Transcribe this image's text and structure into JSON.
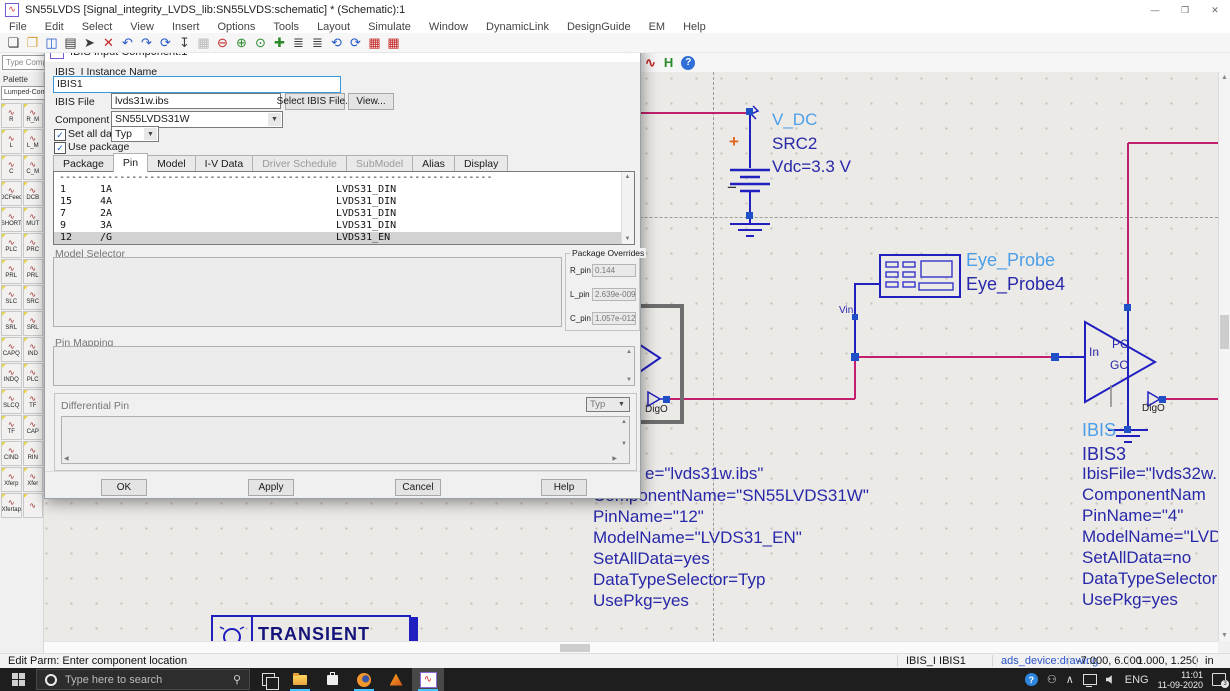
{
  "window": {
    "title": "SN55LVDS [Signal_integrity_LVDS_lib:SN55LVDS:schematic] * (Schematic):1",
    "controls": [
      {
        "g": "—",
        "n": "minimize-button"
      },
      {
        "g": "❐",
        "n": "maximize-button"
      },
      {
        "g": "✕",
        "n": "close-button"
      }
    ]
  },
  "menu": {
    "items": [
      "File",
      "Edit",
      "Select",
      "View",
      "Insert",
      "Options",
      "Tools",
      "Layout",
      "Simulate",
      "Window",
      "DynamicLink",
      "DesignGuide",
      "EM",
      "Help"
    ]
  },
  "toolbar": {
    "icons": [
      {
        "g": "❏",
        "n": "new-design-icon",
        "cls": "c-ink"
      },
      {
        "g": "❐",
        "n": "open-design-icon",
        "cls": "c-folder"
      },
      {
        "g": "◫",
        "n": "save-design-icon",
        "cls": "c-blue"
      },
      {
        "g": "▤",
        "n": "print-icon",
        "cls": "c-ink"
      },
      {
        "g": "➤",
        "n": "select-pointer-icon",
        "cls": "c-ink"
      },
      {
        "g": "✕",
        "n": "delete-icon",
        "cls": "c-red"
      },
      {
        "g": "↶",
        "n": "undo-icon",
        "cls": "c-blue"
      },
      {
        "g": "↷",
        "n": "redo-icon",
        "cls": "c-blue"
      },
      {
        "g": "⟳",
        "n": "redo-all-icon",
        "cls": "c-blue"
      },
      {
        "g": "↧",
        "n": "push-into-hierarchy-icon",
        "cls": "c-ink"
      },
      {
        "g": "▦",
        "n": "grid-icon",
        "cls": "c-dim"
      },
      {
        "g": "⊖",
        "n": "zoom-out-icon",
        "cls": "c-red"
      },
      {
        "g": "⊕",
        "n": "zoom-in-icon",
        "cls": "c-green"
      },
      {
        "g": "⊙",
        "n": "zoom-full-icon",
        "cls": "c-green"
      },
      {
        "g": "✚",
        "n": "zoom-area-icon",
        "cls": "c-green"
      },
      {
        "g": "≣",
        "n": "component-list-icon",
        "cls": "c-ink"
      },
      {
        "g": "≣",
        "n": "wire-label-icon",
        "cls": "c-ink"
      },
      {
        "g": "⟲",
        "n": "rotate-ccw-icon",
        "cls": "c-blue"
      },
      {
        "g": "⟳",
        "n": "rotate-cw-icon",
        "cls": "c-blue"
      },
      {
        "g": "▦",
        "n": "simulate-icon",
        "cls": "c-red"
      },
      {
        "g": "▦",
        "n": "simulation-settings-icon",
        "cls": "c-red"
      }
    ]
  },
  "toolbar2": {
    "search_placeholder": "Type Comp",
    "icons": [
      {
        "g": "∿",
        "n": "data-display-icon",
        "cls": "c-red"
      },
      {
        "g": "H",
        "n": "hierarchy-icon",
        "cls": "c-green"
      },
      {
        "g": "?",
        "n": "help-icon",
        "cls": "c-help"
      }
    ]
  },
  "palette": {
    "header": "Palette",
    "category": "Lumped-Comp",
    "icon_glyph": "∿",
    "rows": [
      {
        "l": "R",
        "r": "R_M"
      },
      {
        "l": "L",
        "r": "L_M"
      },
      {
        "l": "C",
        "r": "C_M"
      },
      {
        "l": "DCFeed",
        "r": "DCB"
      },
      {
        "l": "SHORT",
        "r": "MUT"
      },
      {
        "l": "PLC",
        "r": "PRC"
      },
      {
        "l": "PRL",
        "r": "PRL"
      },
      {
        "l": "SLC",
        "r": "SRC"
      },
      {
        "l": "SRL",
        "r": "SRL"
      },
      {
        "l": "CAPQ",
        "r": "IND"
      },
      {
        "l": "INDQ",
        "r": "PLC"
      },
      {
        "l": "SLCQ",
        "r": "TF"
      },
      {
        "l": "TF",
        "r": "CAP"
      },
      {
        "l": "CIND",
        "r": "RIN"
      },
      {
        "l": "Xferp",
        "r": "Xfer"
      },
      {
        "l": "Xfertap",
        "r": ""
      }
    ]
  },
  "dialog": {
    "title": "IBIS Input Component:1",
    "close_glyph": "✕",
    "instance_label": "IBIS_I Instance Name",
    "instance_value": "IBIS1",
    "ibis_file_label": "IBIS File",
    "ibis_file_value": "lvds31w.ibs",
    "select_ibis_button": "Select IBIS File...",
    "view_button": "View...",
    "component_label": "Component",
    "component_value": "SN55LVDS31W",
    "set_all_data_label": "Set all data",
    "data_type_value": "Typ",
    "use_package_label": "Use package",
    "check_glyph": "✓",
    "tabs": [
      {
        "label": "Package"
      },
      {
        "label": "Pin",
        "active": true
      },
      {
        "label": "Model"
      },
      {
        "label": "I-V Data"
      },
      {
        "label": "Driver Schedule",
        "disabled": true
      },
      {
        "label": "SubModel",
        "disabled": true
      },
      {
        "label": "Alias"
      },
      {
        "label": "Display"
      }
    ],
    "pin_separator": "------------------------------------------------------------------------",
    "pin_rows": [
      {
        "pin": "1",
        "name": "1A",
        "model": "LVDS31_DIN"
      },
      {
        "pin": "15",
        "name": "4A",
        "model": "LVDS31_DIN"
      },
      {
        "pin": "7",
        "name": "2A",
        "model": "LVDS31_DIN"
      },
      {
        "pin": "9",
        "name": "3A",
        "model": "LVDS31_DIN"
      },
      {
        "pin": "12",
        "name": "/G",
        "model": "LVDS31_EN",
        "selected": true
      }
    ],
    "model_selector_label": "Model Selector",
    "package_overrides": {
      "title": "Package Overrides",
      "r_pin_label": "R_pin",
      "r_pin": "0.144",
      "l_pin_label": "L_pin",
      "l_pin": "2.639e-009",
      "c_pin_label": "C_pin",
      "c_pin": "1.057e-012"
    },
    "pin_mapping_label": "Pin Mapping",
    "differential_pin_label": "Differential Pin",
    "differential_type_value": "Typ",
    "buttons": {
      "ok": "OK",
      "apply": "Apply",
      "cancel": "Cancel",
      "help": "Help"
    }
  },
  "schematic": {
    "vdc": {
      "type": "V_DC",
      "name": "SRC2",
      "value": "Vdc=3.3 V",
      "plus": "+",
      "minus": "−"
    },
    "eye_probe": {
      "type": "Eye_Probe",
      "name": "Eye_Probe4"
    },
    "vin": "Vin",
    "ibis1_out": "DigO",
    "ibis3": {
      "type": "IBIS",
      "name": "IBIS3",
      "pin_in": "In",
      "pin_pc": "PC",
      "pin_gc": "GC",
      "out": "DigO"
    },
    "annotation_left_first": "e=\"lvds31w.ibs\"",
    "annotations_left": [
      "ComponentName=\"SN55LVDS31W\"",
      "PinName=\"12\"",
      "ModelName=\"LVDS31_EN\"",
      "SetAllData=yes",
      "DataTypeSelector=Typ",
      "UsePkg=yes"
    ],
    "annotations_right": [
      "IbisFile=\"lvds32w.",
      "ComponentNam",
      "PinName=\"4\"",
      "ModelName=\"LVD",
      "SetAllData=no",
      "DataTypeSelector",
      "UsePkg=yes"
    ],
    "transient": "TRANSIENT"
  },
  "statusbar": {
    "message": "Edit Parm: Enter component location",
    "instance": "IBIS_I IBIS1",
    "context": "ads_device:drawing",
    "coord1": "-7.000, 6.000",
    "coord2": "1.000, 1.250",
    "units": "in"
  },
  "taskbar": {
    "search_placeholder": "Type here to search",
    "mic_glyph": "⚲",
    "language": "ENG",
    "time": "11:01",
    "date": "11-09-2020",
    "notification_count": "3",
    "hidden_icons_glyph": "∧",
    "people_glyph": "⚇"
  }
}
